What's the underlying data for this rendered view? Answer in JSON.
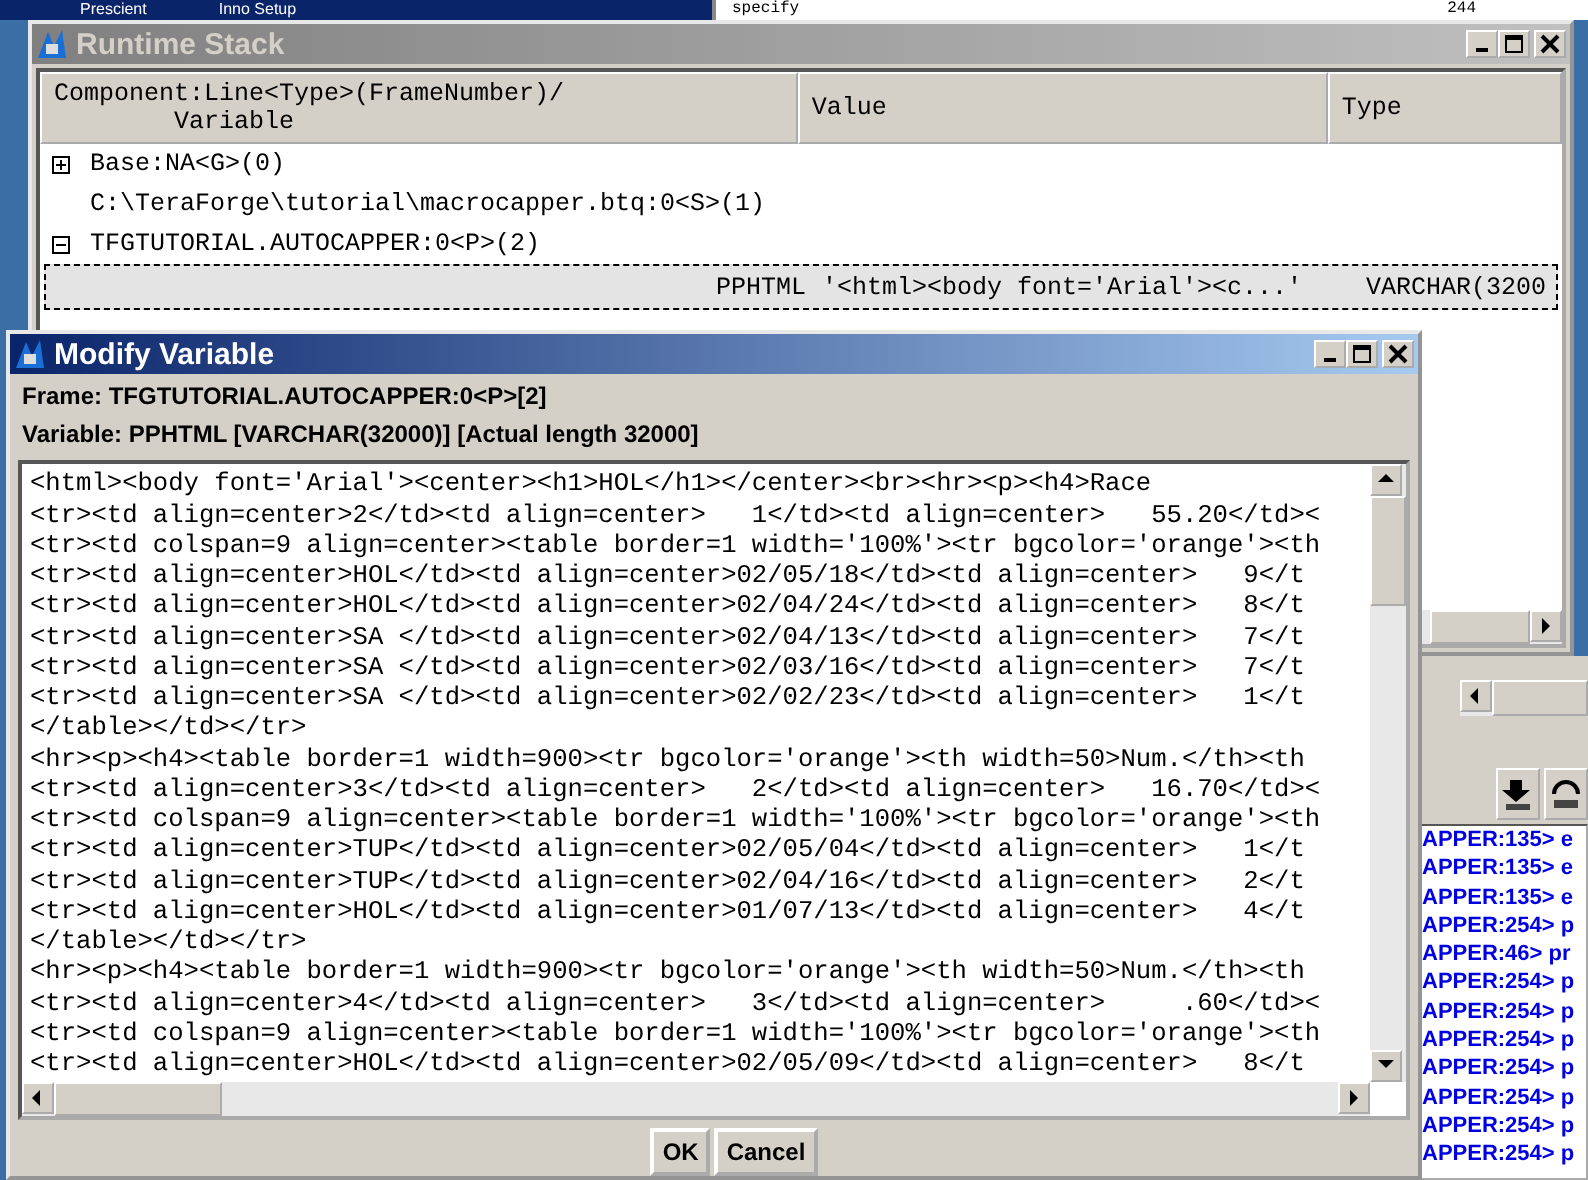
{
  "taskbar": {
    "items": [
      "Prescient",
      "Inno Setup"
    ]
  },
  "background_window": {
    "texts": [
      "specify",
      "244"
    ]
  },
  "runtime_stack": {
    "title": "Runtime Stack",
    "active": false,
    "columns": [
      {
        "label": [
          "Component:Line<Type>(FrameNumber)/",
          "Variable"
        ]
      },
      {
        "label": [
          "Value"
        ]
      },
      {
        "label": [
          "Type"
        ]
      }
    ],
    "rows": [
      {
        "kind": "node",
        "expanded": false,
        "label": "Base:NA<G>(0)"
      },
      {
        "kind": "leaf",
        "label": "C:\\TeraForge\\tutorial\\macrocapper.btq:0<S>(1)"
      },
      {
        "kind": "node",
        "expanded": true,
        "label": "TFGTUTORIAL.AUTOCAPPER:0<P>(2)",
        "children": [
          {
            "kind": "variable",
            "name": "PPHTML",
            "value": "'<html><body font='Arial'><c...'",
            "type": "VARCHAR(3200",
            "selected": true
          }
        ]
      }
    ]
  },
  "log": {
    "lines": [
      "APPER:135> e",
      "APPER:135> e",
      "APPER:135> e",
      "APPER:254> p",
      "APPER:46> pr",
      "APPER:254> p",
      "APPER:254> p",
      "APPER:254> p",
      "APPER:254> p",
      "APPER:254> p",
      "APPER:254> p",
      "APPER:254> p"
    ]
  },
  "modify_variable": {
    "title": "Modify Variable",
    "active": true,
    "frame": "Frame: TFGTUTORIAL.AUTOCAPPER:0<P>[2]",
    "variable": "Variable: PPHTML [VARCHAR(32000)] [Actual length 32000]",
    "text_lines": [
      "<html><body font='Arial'><center><h1>HOL</h1></center><br><hr><p><h4>Race",
      "<tr><td align=center>2</td><td align=center>   1</td><td align=center>   55.20</td><",
      "<tr><td colspan=9 align=center><table border=1 width='100%'><tr bgcolor='orange'><th",
      "<tr><td align=center>HOL</td><td align=center>02/05/18</td><td align=center>   9</t",
      "<tr><td align=center>HOL</td><td align=center>02/04/24</td><td align=center>   8</t",
      "<tr><td align=center>SA </td><td align=center>02/04/13</td><td align=center>   7</t",
      "<tr><td align=center>SA </td><td align=center>02/03/16</td><td align=center>   7</t",
      "<tr><td align=center>SA </td><td align=center>02/02/23</td><td align=center>   1</t",
      "</table></td></tr>",
      "<hr><p><h4><table border=1 width=900><tr bgcolor='orange'><th width=50>Num.</th><th",
      "<tr><td align=center>3</td><td align=center>   2</td><td align=center>   16.70</td><",
      "<tr><td colspan=9 align=center><table border=1 width='100%'><tr bgcolor='orange'><th",
      "<tr><td align=center>TUP</td><td align=center>02/05/04</td><td align=center>   1</t",
      "<tr><td align=center>TUP</td><td align=center>02/04/16</td><td align=center>   2</t",
      "<tr><td align=center>HOL</td><td align=center>01/07/13</td><td align=center>   4</t",
      "</table></td></tr>",
      "<hr><p><h4><table border=1 width=900><tr bgcolor='orange'><th width=50>Num.</th><th",
      "<tr><td align=center>4</td><td align=center>   3</td><td align=center>     .60</td><",
      "<tr><td colspan=9 align=center><table border=1 width='100%'><tr bgcolor='orange'><th",
      "<tr><td align=center>HOL</td><td align=center>02/05/09</td><td align=center>   8</t"
    ],
    "buttons": [
      "OK",
      "Cancel"
    ]
  }
}
